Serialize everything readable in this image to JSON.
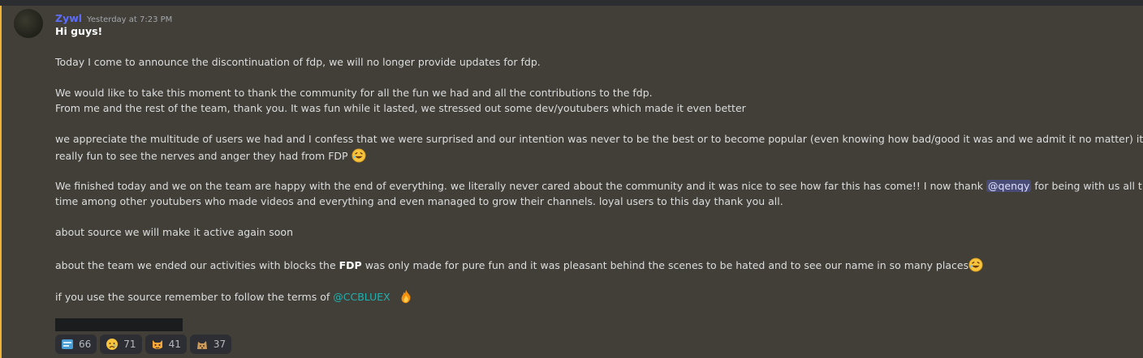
{
  "message": {
    "author": "Zywl",
    "timestamp": "Yesterday at 7:23 PM",
    "greeting": "Hi guys!",
    "p1": "Today I come to announce the discontinuation of fdp, we will no longer provide updates for fdp.",
    "p2a": "We would like to take this moment to thank the community for all the fun we had and all the contributions to the fdp.",
    "p2b": "From me and the rest of the team, thank you. It was fun while it lasted, we stressed out some dev/youtubers which made it even better",
    "p3a": "we appreciate the multitude of users we had and I confess that we were surprised and our intention was never to be the best or to become popular (even knowing how bad/good it was and we admit it no matter) it was",
    "p3b": "really fun to see the nerves and anger they had from FDP",
    "p4a_pre": "We finished today and we on the team are happy with the end of everything. we literally never cared about the community and it was nice to see how far this has come!! I now thank",
    "p4a_mention": "@qenqy",
    "p4a_post": "for being with us all this",
    "p4b": "time among other youtubers who made videos and everything and even managed to grow their channels. loyal users to this day thank you all.",
    "p5": "about source we will make it active again soon",
    "p6_pre": "about the team we ended our activities with blocks the",
    "p6_bold": "FDP",
    "p6_post": "was only made for pure fun and it was pleasant behind the scenes to be hated and to see our name in so many places",
    "p7_pre": "if you use the source remember to follow the terms of",
    "p7_link": "@CCBLUEX"
  },
  "reactions": [
    {
      "icon": "blue-box-emoji",
      "count": "66"
    },
    {
      "icon": "crying-face-emoji",
      "count": "71"
    },
    {
      "icon": "cat-face-emoji",
      "count": "41"
    },
    {
      "icon": "doge-emoji",
      "count": "37"
    }
  ],
  "colors": {
    "background": "#423f38",
    "username": "#5b6cff",
    "link": "#20b0b0",
    "accent": "#f0b232"
  }
}
